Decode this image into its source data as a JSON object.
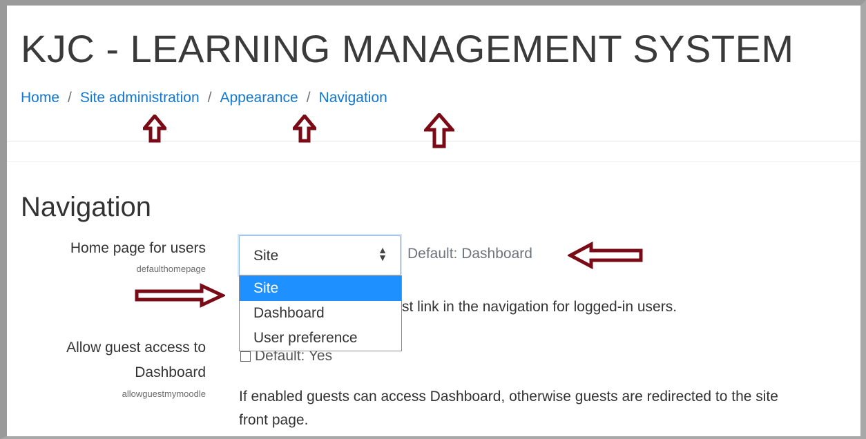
{
  "header": {
    "site_title": "KJC - LEARNING MANAGEMENT SYSTEM"
  },
  "breadcrumb": {
    "items": [
      "Home",
      "Site administration",
      "Appearance",
      "Navigation"
    ],
    "separator": "/"
  },
  "page": {
    "heading": "Navigation"
  },
  "settings": {
    "homepage": {
      "label": "Home page for users",
      "key": "defaulthomepage",
      "selected": "Site",
      "default_text": "Default: Dashboard",
      "options": [
        "Site",
        "Dashboard",
        "User preference"
      ],
      "description_visible": "st link in the navigation for logged-in users."
    },
    "guest": {
      "label_line1": "Allow guest access to",
      "label_line2": "Dashboard",
      "key": "allowguestmymoodle",
      "checkbox_text": "Default: Yes",
      "description_line1": "If enabled guests can access Dashboard, otherwise guests are redirected to the site",
      "description_line2": "front page."
    }
  },
  "colors": {
    "link": "#1177d1",
    "selected_option": "#1e90ff",
    "annotation_arrow": "#7a0a16"
  },
  "annotations": {
    "icon": "arrow-annotation-icon"
  }
}
